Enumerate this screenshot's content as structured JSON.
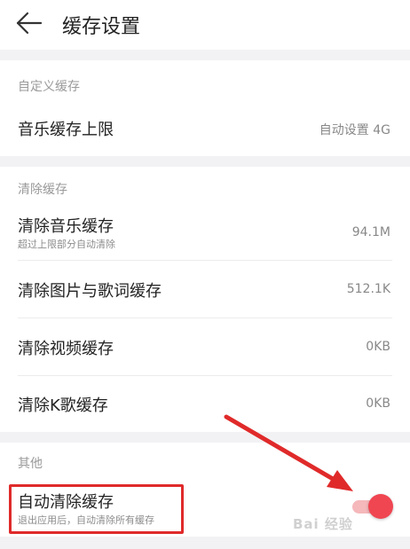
{
  "header": {
    "title": "缓存设置"
  },
  "sections": {
    "custom": {
      "label": "自定义缓存"
    },
    "clear": {
      "label": "清除缓存"
    },
    "other": {
      "label": "其他"
    }
  },
  "rows": {
    "music_limit": {
      "label": "音乐缓存上限",
      "value": "自动设置 4G"
    },
    "clear_music": {
      "label": "清除音乐缓存",
      "sub": "超过上限部分自动清除",
      "value": "94.1M"
    },
    "clear_images_lyrics": {
      "label": "清除图片与歌词缓存",
      "value": "512.1K"
    },
    "clear_video": {
      "label": "清除视频缓存",
      "value": "0KB"
    },
    "clear_ksong": {
      "label": "清除K歌缓存",
      "value": "0KB"
    },
    "auto_clear": {
      "label": "自动清除缓存",
      "sub": "退出应用后，自动清除所有缓存",
      "enabled": true
    }
  },
  "colors": {
    "accent": "#f04652",
    "annotation": "#e02a2a"
  },
  "watermark": {
    "text": "Bai 经验"
  }
}
